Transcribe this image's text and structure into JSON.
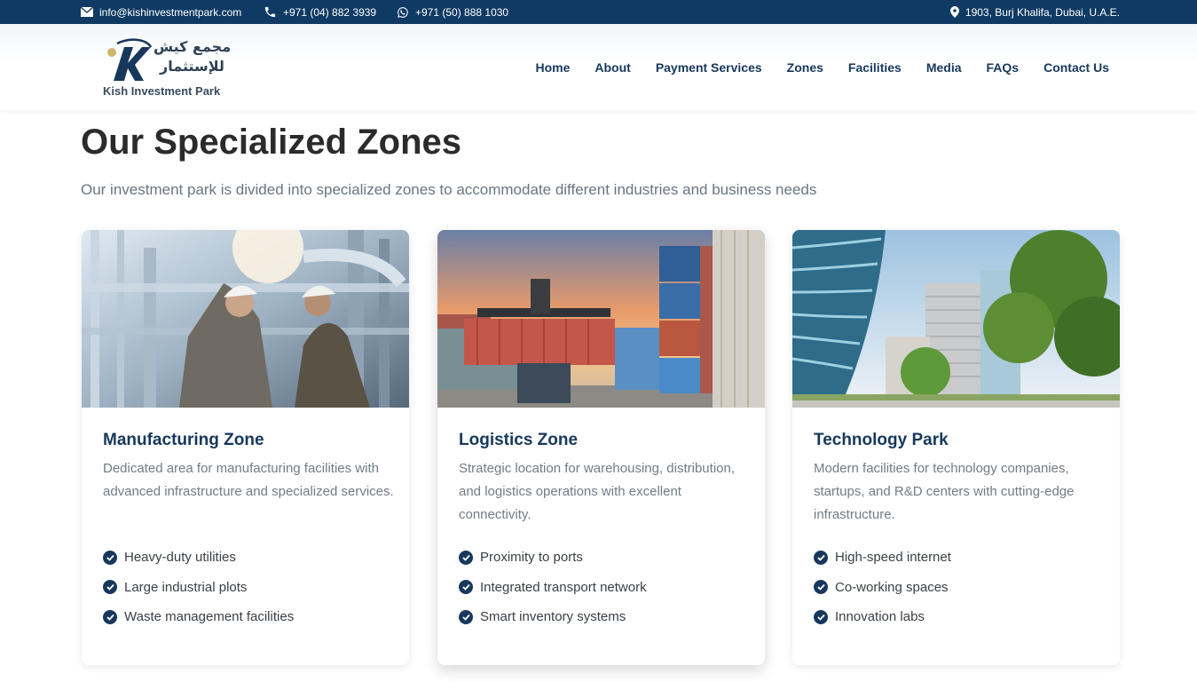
{
  "topbar": {
    "email": "info@kishinvestmentpark.com",
    "phone": "+971 (04) 882 3939",
    "whatsapp": "+971 (50) 888 1030",
    "address": "1903, Burj Khalifa, Dubai, U.A.E.",
    "icons": [
      "envelope-icon",
      "phone-icon",
      "whatsapp-icon",
      "map-pin-icon"
    ]
  },
  "logo": {
    "arabic_line1": "مجمع كيش",
    "arabic_line2": "للإستثمار",
    "english": "Kish Investment Park"
  },
  "nav": [
    "Home",
    "About",
    "Payment Services",
    "Zones",
    "Facilities",
    "Media",
    "FAQs",
    "Contact Us"
  ],
  "section": {
    "title": "Our Specialized Zones",
    "subtitle": "Our investment park is divided into specialized zones to accommodate different industries and business needs"
  },
  "zones": [
    {
      "title": "Manufacturing Zone",
      "description": "Dedicated area for manufacturing facilities with advanced infrastructure and specialized services.",
      "features": [
        "Heavy-duty utilities",
        "Large industrial plots",
        "Waste management facilities"
      ]
    },
    {
      "title": "Logistics Zone",
      "description": "Strategic location for warehousing, distribution, and logistics operations with excellent connectivity.",
      "features": [
        "Proximity to ports",
        "Integrated transport network",
        "Smart inventory systems"
      ]
    },
    {
      "title": "Technology Park",
      "description": "Modern facilities for technology companies, startups, and R&D centers with cutting-edge infrastructure.",
      "features": [
        "High-speed internet",
        "Co-working spaces",
        "Innovation labs"
      ]
    }
  ],
  "colors": {
    "brand_navy": "#0f3a63",
    "heading_navy": "#17385c",
    "logo_gold": "#d2b46e"
  }
}
